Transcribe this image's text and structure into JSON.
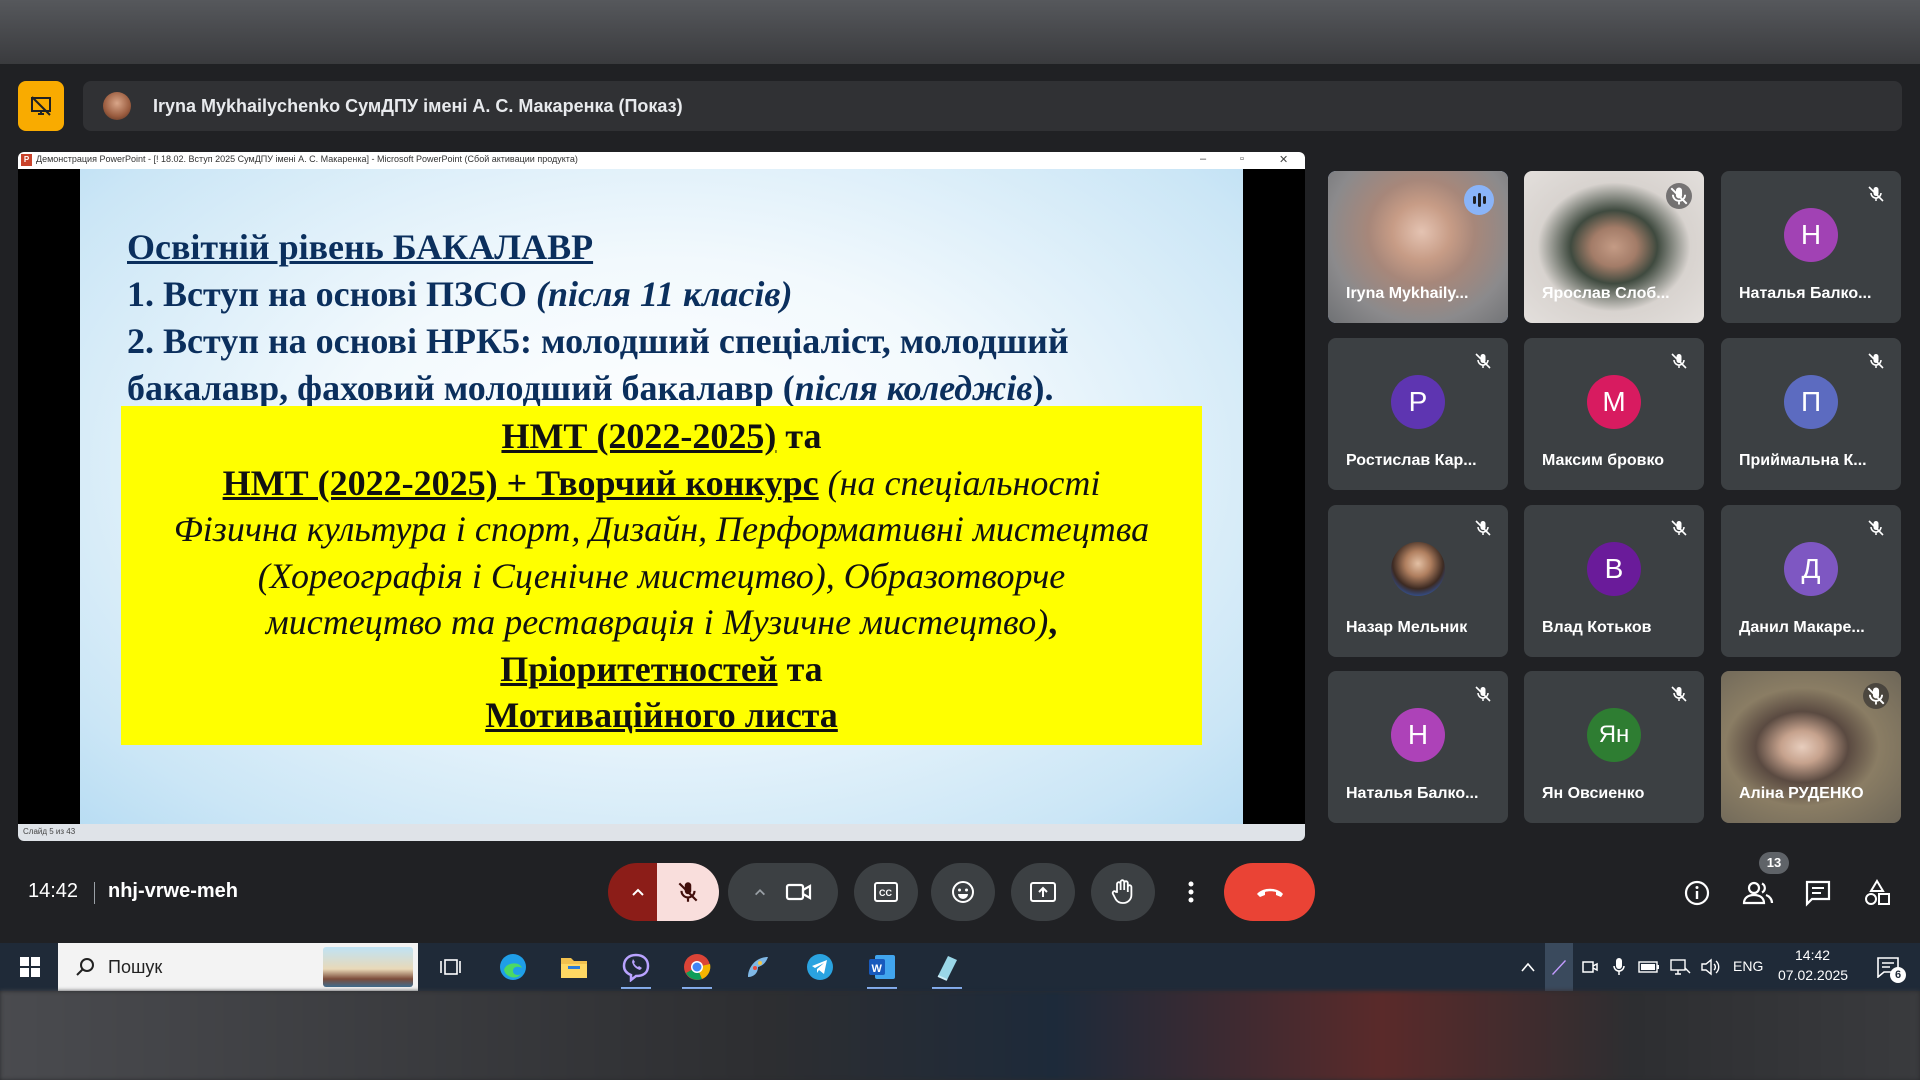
{
  "presenter": {
    "name": "Iryna Mykhailychenko СумДПУ імені А. С. Макаренка (Показ)"
  },
  "ppt": {
    "window_title": "Демонстрация PowerPoint - [! 18.02. Вступ 2025 СумДПУ імені А. С. Макаренка] - Microsoft PowerPoint (Сбой активации продукта)",
    "status": "Слайд 5 из 43",
    "logo": "P"
  },
  "slide": {
    "title": "Освітній рівень БАКАЛАВР",
    "line1_main": "1. Вступ на основі ПЗСО ",
    "line1_italic": "(після 11 класів)",
    "line2": "2. Вступ на основі НРК5: молодший спеціаліст, молодший",
    "line3_main": "бакалавр, фаховий молодший бакалавр (",
    "line3_italic": "після коледжів",
    "line3_end": ").",
    "box": {
      "l1_u": "НМТ (2022-2025)",
      "l1_rest": " та",
      "l2_u": "НМТ (2022-2025) + Творчий конкурс",
      "l2_i": " (на спеціальності",
      "l3": "Фізична культура і спорт, Дизайн, Перформативні мистецтва",
      "l4": "(Хореографія і Сценічне мистецтво), Образотворче",
      "l5_i": "мистецтво та реставрація і Музичне мистецтво)",
      "l5_end": ",",
      "l6_u": "Пріоритетностей",
      "l6_rest": " та",
      "l7_u": "Мотиваційного листа"
    }
  },
  "participants": [
    {
      "name": "Iryna Mykhaily...",
      "initial": "",
      "color": "",
      "video": true,
      "speaking": true
    },
    {
      "name": "Ярослав Слоб...",
      "initial": "",
      "color": "",
      "video": true,
      "speaking": false
    },
    {
      "name": "Наталья Балко...",
      "initial": "Н",
      "color": "#a142b4",
      "video": false,
      "speaking": false
    },
    {
      "name": "Ростислав Кар...",
      "initial": "Р",
      "color": "#5e35b1",
      "video": false,
      "speaking": false
    },
    {
      "name": "Максим бровко",
      "initial": "М",
      "color": "#d81b60",
      "video": false,
      "speaking": false
    },
    {
      "name": "Приймальна К...",
      "initial": "П",
      "color": "#5c6bc0",
      "video": false,
      "speaking": false
    },
    {
      "name": "Назар Мельник",
      "initial": "",
      "color": "",
      "video": false,
      "speaking": false
    },
    {
      "name": "Влад Котьков",
      "initial": "В",
      "color": "#6a1b9a",
      "video": false,
      "speaking": false
    },
    {
      "name": "Данил Макаре...",
      "initial": "Д",
      "color": "#7e57c2",
      "video": false,
      "speaking": false
    },
    {
      "name": "Наталья Балко...",
      "initial": "Н",
      "color": "#ad42b8",
      "video": false,
      "speaking": false
    },
    {
      "name": "Ян Овсиенко",
      "initial": "Ян",
      "color": "#2e7d32",
      "video": false,
      "speaking": false
    },
    {
      "name": "Аліна РУДЕНКО",
      "initial": "",
      "color": "",
      "video": true,
      "speaking": false
    }
  ],
  "footer": {
    "time": "14:42",
    "meeting_code": "nhj-vrwe-meh",
    "participant_count": "13"
  },
  "taskbar": {
    "search_placeholder": "Пошук",
    "lang": "ENG",
    "clock_time": "14:42",
    "clock_date": "07.02.2025",
    "notifications": "6"
  },
  "colors": {
    "accent": "#8ab4f8",
    "present_yellow": "#f9ab00",
    "hangup": "#ea4335",
    "mic_off_bg": "#8c1d18"
  }
}
